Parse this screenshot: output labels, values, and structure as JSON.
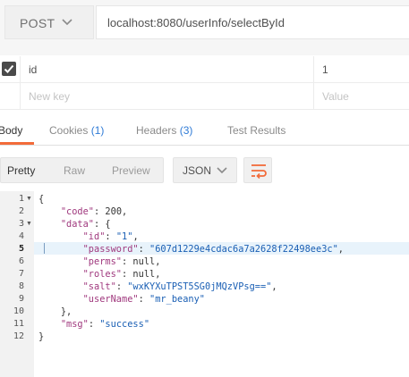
{
  "request": {
    "method": "POST",
    "url": "localhost:8080/userInfo/selectById"
  },
  "params": {
    "rows": [
      {
        "key": "id",
        "value": "1"
      }
    ],
    "key_placeholder": "New key",
    "value_placeholder": "Value"
  },
  "tabs": {
    "body": "Body",
    "cookies": "Cookies",
    "cookies_count": "(1)",
    "headers": "Headers",
    "headers_count": "(3)",
    "tests": "Test Results"
  },
  "view": {
    "pretty": "Pretty",
    "raw": "Raw",
    "preview": "Preview",
    "format": "JSON"
  },
  "code": {
    "line_numbers": [
      "1",
      "2",
      "3",
      "4",
      "5",
      "6",
      "7",
      "8",
      "9",
      "10",
      "11",
      "12"
    ],
    "code_key": "\"code\"",
    "code_val": "200",
    "data_key": "\"data\"",
    "id_key": "\"id\"",
    "id_val": "\"1\"",
    "password_key": "\"password\"",
    "password_val": "\"607d1229e4cdac6a7a2628f22498ee3c\"",
    "perms_key": "\"perms\"",
    "perms_val": "null",
    "roles_key": "\"roles\"",
    "roles_val": "null",
    "salt_key": "\"salt\"",
    "salt_val": "\"wxKYXuTPST5SG0jMQzVPsg==\"",
    "username_key": "\"userName\"",
    "username_val": "\"mr_beany\"",
    "msg_key": "\"msg\"",
    "msg_val": "\"success\""
  },
  "colors": {
    "accent": "#f26b3a",
    "count": "#2f7bd6",
    "json_key": "#a0397e",
    "json_string": "#1a5fb4"
  },
  "icons": [
    "chevron-down-icon",
    "checkbox-checked-icon",
    "wrap-lines-icon",
    "fold-arrow-icon"
  ]
}
